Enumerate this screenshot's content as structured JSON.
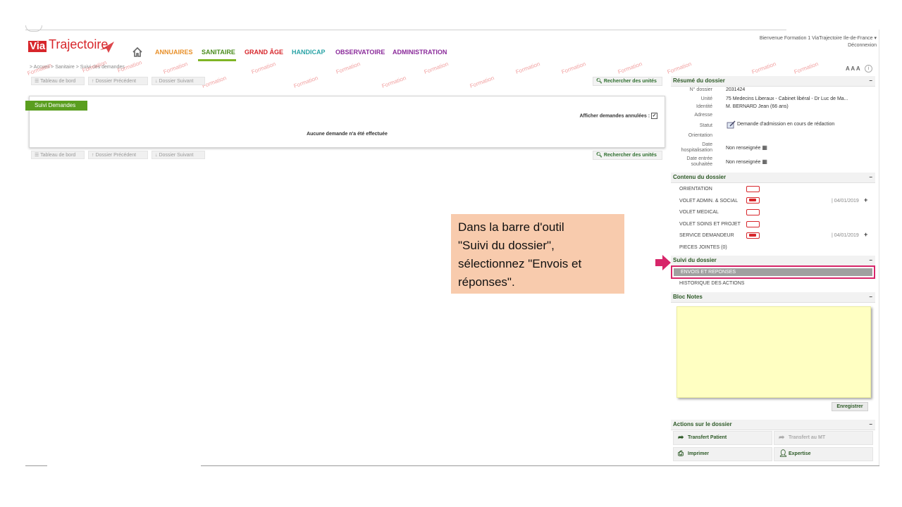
{
  "header": {
    "logo_via": "Via",
    "logo_trajectoire": "Trajectoire",
    "nav": [
      "ANNUAIRES",
      "SANITAIRE",
      "GRAND ÂGE",
      "HANDICAP",
      "OBSERVATOIRE",
      "ADMINISTRATION"
    ],
    "nav_colors": [
      "#e8902a",
      "#4a8c1c",
      "#d7262b",
      "#2aa3a6",
      "#8a2a9a",
      "#8a2a9a"
    ],
    "welcome": "Bienvenue Formation 1 ViaTrajectoire Ile-de-France",
    "logout": "Déconnexion"
  },
  "breadcrumb": {
    "text": "> Accueil > Sanitaire > Suivi des demandes",
    "font_controls": "A A A"
  },
  "toolbar": {
    "dashboard": "Tableau de bord",
    "previous": "Dossier Précédent",
    "next": "Dossier Suivant",
    "search_units": "Rechercher des unités"
  },
  "watermark": "Formation",
  "main": {
    "tab_label": "Suivi Demandes",
    "show_cancelled": "Afficher demandes annulées :",
    "empty_message": "Aucune demande n'a été effectuée"
  },
  "summary": {
    "title": "Résumé du dossier",
    "rows": [
      {
        "label": "N° dossier",
        "value": "2031424"
      },
      {
        "label": "Unité",
        "value": "75 Medecins Liberaux - Cabinet libéral - Dr Luc de Ma..."
      },
      {
        "label": "Identité",
        "value": "M. BERNARD Jean (66 ans)"
      },
      {
        "label": "Adresse",
        "value": ""
      },
      {
        "label": "Statut",
        "value": "Demande d'admission en cours de rédaction"
      },
      {
        "label": "Orientation",
        "value": ""
      },
      {
        "label": "Date hospitalisation",
        "value": "Non renseignée"
      },
      {
        "label": "Date entrée souhaitée",
        "value": "Non renseignée"
      }
    ]
  },
  "contents": {
    "title": "Contenu du dossier",
    "items": [
      {
        "label": "ORIENTATION",
        "date": ""
      },
      {
        "label": "VOLET ADMIN. & SOCIAL",
        "date": "04/01/2019"
      },
      {
        "label": "VOLET MEDICAL",
        "date": ""
      },
      {
        "label": "VOLET SOINS ET PROJET",
        "date": ""
      },
      {
        "label": "SERVICE DEMANDEUR",
        "date": "04/01/2019"
      },
      {
        "label": "PIECES JOINTES (0)",
        "date": ""
      }
    ]
  },
  "followup": {
    "title": "Suivi du dossier",
    "items": [
      "ENVOIS ET REPONSES",
      "HISTORIQUE DES ACTIONS"
    ]
  },
  "notes": {
    "title": "Bloc Notes",
    "save": "Enregistrer"
  },
  "actions": {
    "title": "Actions sur le dossier",
    "transfer_patient": "Transfert Patient",
    "transfer_mt": "Transfert au MT",
    "print": "Imprimer",
    "expertise": "Expertise"
  },
  "callout": {
    "lines": [
      "Dans la barre d'outil",
      "\"Suivi du dossier\",",
      "sélectionnez \"Envois et",
      "réponses\"."
    ]
  },
  "colors": {
    "accent_green": "#5a9e1f",
    "brand_red": "#d7262b",
    "highlight": "#d7266a",
    "callout_bg": "#f8cbad",
    "notes_bg": "#ffffc2"
  }
}
